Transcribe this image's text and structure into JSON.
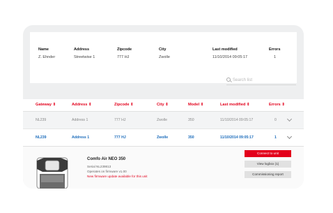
{
  "summary": {
    "headers": [
      "Name",
      "Address",
      "Zipcode",
      "City",
      "Last modified",
      "Errors"
    ],
    "values": [
      "Z. Ehnder",
      "Streetwise 1",
      "777 HJ",
      "Zwolle",
      "11/10/2014 09:05:17",
      "1"
    ]
  },
  "search": {
    "placeholder": "Search list",
    "icon": "search-icon"
  },
  "table": {
    "headers": [
      "Gateway",
      "Address",
      "Zipcode",
      "City",
      "Model",
      "Last modified",
      "Errors"
    ],
    "sort_indicator": "⇕",
    "rows": [
      [
        "NL239",
        "Address 1",
        "777 HJ",
        "Zwolle",
        "350",
        "11/10/2014 09:05:17",
        "0"
      ],
      [
        "NL239",
        "Address 1",
        "777 HJ",
        "Zwolle",
        "350",
        "11/10/2014 09:05:17",
        "1"
      ]
    ]
  },
  "detail": {
    "name": "Comfo Air NEO 350",
    "serial": "Serial NL239813",
    "firmware": "Operates on firmware v1.00",
    "warning": "New firmware update available for this unit",
    "buttons": {
      "connect": "Connect to unit",
      "logbook": "View logbox (1)",
      "report": "Commissioning report"
    }
  },
  "colors": {
    "accent": "#e3001b",
    "link": "#1a6bbb",
    "panel": "#eeeff0"
  }
}
